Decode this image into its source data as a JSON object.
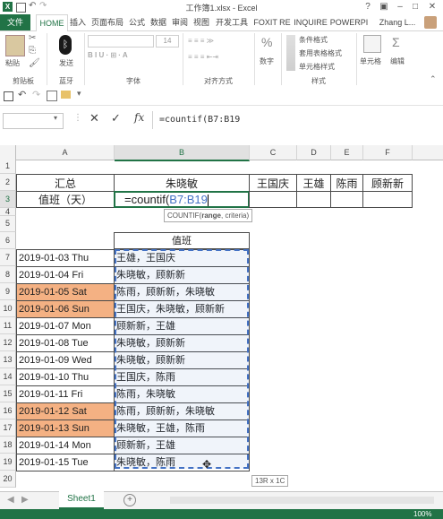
{
  "window": {
    "title": "工作簿1.xlsx - Excel",
    "help": "?",
    "user": "Zhang L..."
  },
  "tabs": [
    "文件",
    "HOME",
    "插入",
    "页面布局",
    "公式",
    "数据",
    "审阅",
    "视图",
    "开发工具",
    "FOXIT RE",
    "INQUIRE",
    "POWERPI"
  ],
  "ribbon": {
    "paste": "粘贴",
    "clipboard": "剪贴板",
    "bluetooth_send": "发送",
    "bluetooth_group": "蓝牙",
    "font_group": "字体",
    "font_size": "14",
    "align_group": "对齐方式",
    "number": "数字",
    "cond_format": "条件格式",
    "table_format": "套用表格格式",
    "cell_style": "单元格样式",
    "styles_group": "样式",
    "cells": "单元格",
    "edit": "编辑"
  },
  "formula_bar": {
    "name_box": "",
    "fx": "fx",
    "formula": "=countif(B7:B19"
  },
  "columns": [
    "A",
    "B",
    "C",
    "D",
    "E",
    "F"
  ],
  "rows": [
    "1",
    "2",
    "3",
    "4",
    "5",
    "6",
    "7",
    "8",
    "9",
    "10",
    "11",
    "12",
    "13",
    "14",
    "15",
    "16",
    "17",
    "18",
    "19",
    "20"
  ],
  "summary": {
    "a2": "汇总",
    "b2": "朱晓敏",
    "c2": "王国庆",
    "d2": "王雄",
    "e2": "陈雨",
    "f2": "顾新新",
    "a3": "值班（天）",
    "b3_prefix": "=countif(",
    "b3_ref": "B7:B19",
    "tooltip_fn": "COUNTIF(",
    "tooltip_arg1": "range",
    "tooltip_rest": ", criteria)"
  },
  "duty_header": "值班",
  "duty": [
    {
      "date": "2019-01-03 Thu",
      "names": "王雄，王国庆",
      "weekend": false
    },
    {
      "date": "2019-01-04 Fri",
      "names": "朱晓敏，顾新新",
      "weekend": false
    },
    {
      "date": "2019-01-05 Sat",
      "names": "陈雨，顾新新，朱晓敏",
      "weekend": true
    },
    {
      "date": "2019-01-06 Sun",
      "names": "王国庆，朱晓敏，顾新新",
      "weekend": true
    },
    {
      "date": "2019-01-07 Mon",
      "names": "顾新新，王雄",
      "weekend": false
    },
    {
      "date": "2019-01-08 Tue",
      "names": "朱晓敏，顾新新",
      "weekend": false
    },
    {
      "date": "2019-01-09 Wed",
      "names": "朱晓敏，顾新新",
      "weekend": false
    },
    {
      "date": "2019-01-10 Thu",
      "names": "王国庆，陈雨",
      "weekend": false
    },
    {
      "date": "2019-01-11 Fri",
      "names": "陈雨，朱晓敏",
      "weekend": false
    },
    {
      "date": "2019-01-12 Sat",
      "names": "陈雨，顾新新，朱晓敏",
      "weekend": true
    },
    {
      "date": "2019-01-13 Sun",
      "names": "朱晓敏，王雄，陈雨",
      "weekend": true
    },
    {
      "date": "2019-01-14 Mon",
      "names": "顾新新，王雄",
      "weekend": false
    },
    {
      "date": "2019-01-15 Tue",
      "names": "朱晓敏，陈雨",
      "weekend": false
    }
  ],
  "range_tip": "13R x 1C",
  "sheet_tab": "Sheet1",
  "zoom": "100%",
  "colors": {
    "excel_green": "#217346",
    "weekend": "#f4b183",
    "ref_blue": "#4472c4"
  }
}
